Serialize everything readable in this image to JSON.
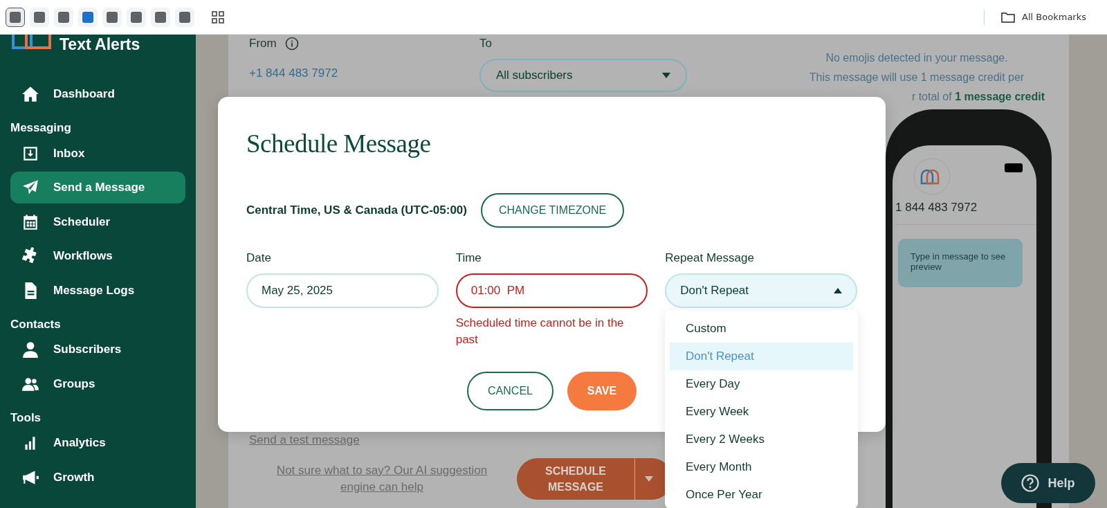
{
  "browser_bar": {
    "shortcuts": [
      {
        "color": "#5f6368",
        "selected": true
      },
      {
        "color": "#5f6368",
        "selected": false
      },
      {
        "color": "#5f6368",
        "selected": false
      },
      {
        "color": "#1a73c8",
        "selected": false
      },
      {
        "color": "#5f6368",
        "selected": false
      },
      {
        "color": "#5f6368",
        "selected": false
      },
      {
        "color": "#5f6368",
        "selected": false
      },
      {
        "color": "#5f6368",
        "selected": false
      }
    ],
    "bookmarks": "All Bookmarks"
  },
  "sidebar": {
    "brand": "Text Alerts",
    "sections": [
      {
        "items": [
          {
            "label": "Dashboard",
            "kind": "home",
            "selected": false
          }
        ]
      },
      {
        "heading": "Messaging",
        "items": [
          {
            "label": "Inbox",
            "kind": "inbox",
            "selected": false
          },
          {
            "label": "Send a Message",
            "kind": "send",
            "selected": true
          },
          {
            "label": "Scheduler",
            "kind": "calendar",
            "selected": false
          },
          {
            "label": "Workflows",
            "kind": "puzzle",
            "selected": false
          },
          {
            "label": "Message Logs",
            "kind": "document",
            "selected": false
          }
        ]
      },
      {
        "heading": "Contacts",
        "items": [
          {
            "label": "Subscribers",
            "kind": "person",
            "selected": false
          },
          {
            "label": "Groups",
            "kind": "people",
            "selected": false
          }
        ]
      },
      {
        "heading": "Tools",
        "items": [
          {
            "label": "Analytics",
            "kind": "chart",
            "selected": false
          },
          {
            "label": "Growth",
            "kind": "megaphone",
            "selected": false
          }
        ]
      }
    ]
  },
  "compose": {
    "from_label": "From",
    "from_number": "+1 844 483 7972",
    "to_label": "To",
    "to_value": "All subscribers",
    "emoji_note": "No emojis detected in your message.",
    "credit_line_1": "This message will use 1 message credit per",
    "credit_line_2": "r total of **1 message credit**",
    "preview_number": "1 844 483 7972",
    "preview_bubble": "Type in message to see preview",
    "test_link": "Send a test message",
    "ai_link": "Not sure what to say? Our AI suggestion engine can help",
    "schedule_button": "SCHEDULE MESSAGE"
  },
  "modal": {
    "title": "Schedule Message",
    "timezone": "Central Time, US & Canada (UTC-05:00)",
    "timezone_button": "CHANGE TIMEZONE",
    "fields": [
      {
        "label": "Date",
        "value": "May 25, 2025",
        "invalid": false
      },
      {
        "label": "Time",
        "value": "01:00  PM",
        "invalid": true,
        "error": "Scheduled time cannot be in the past"
      }
    ],
    "repeat": {
      "label": "Repeat Message",
      "value": "Don't Repeat",
      "expanded": true,
      "options": [
        {
          "label": "Custom",
          "selected": false
        },
        {
          "label": "Don't Repeat",
          "selected": true
        },
        {
          "label": "Every Day",
          "selected": false
        },
        {
          "label": "Every Week",
          "selected": false
        },
        {
          "label": "Every 2 Weeks",
          "selected": false
        },
        {
          "label": "Every Month",
          "selected": false
        },
        {
          "label": "Once Per Year",
          "selected": false
        }
      ]
    },
    "cancel": "CANCEL",
    "save": "SAVE"
  },
  "help": {
    "label": "Help"
  }
}
